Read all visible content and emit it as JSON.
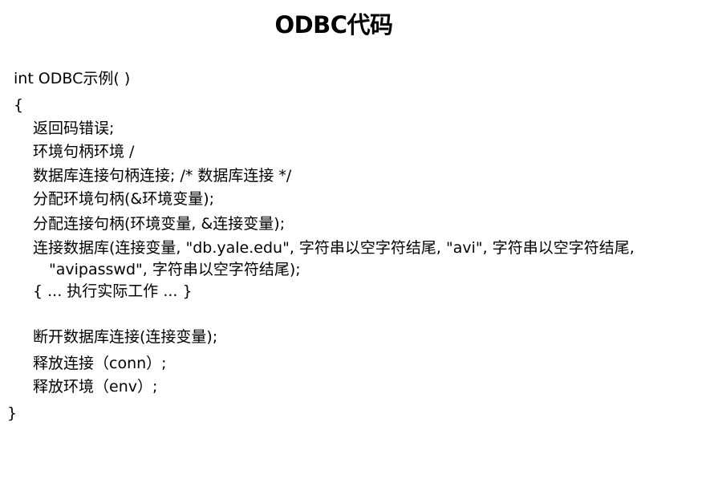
{
  "slide": {
    "title": "ODBC代码",
    "code_lines": [
      "int ODBC示例( )",
      "{",
      "返回码错误;",
      "环境句柄环境 /",
      "数据库连接句柄连接; /* 数据库连接 */",
      "分配环境句柄(&环境变量);",
      "分配连接句柄(环境变量, &连接变量);",
      "连接数据库(连接变量, \"db.yale.edu\", 字符串以空字符结尾, \"avi\", 字符串以空字符结尾,",
      "\"avipasswd\", 字符串以空字符结尾);",
      "{ ... 执行实际工作 ... }",
      "断开数据库连接(连接变量);",
      "释放连接（conn）;",
      "释放环境（env）;",
      "}"
    ]
  }
}
